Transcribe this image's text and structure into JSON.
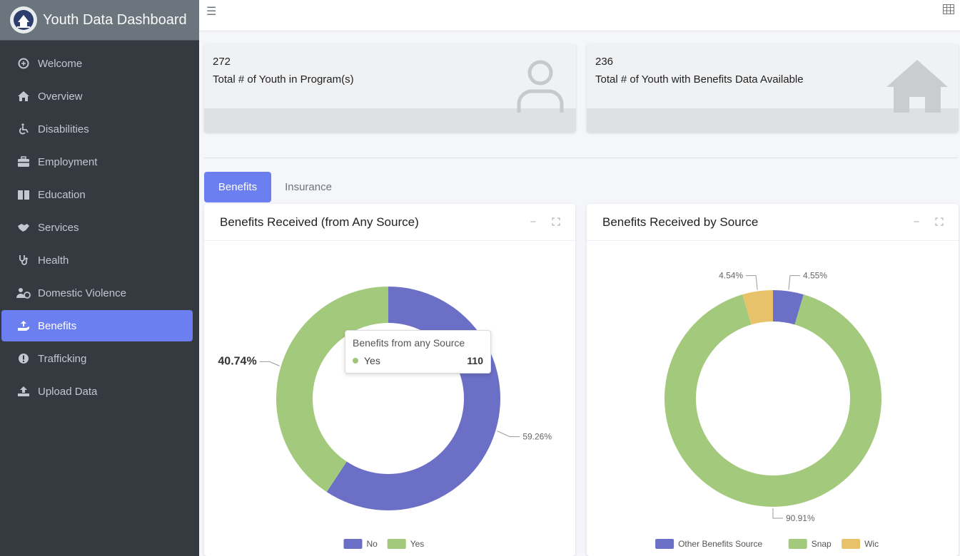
{
  "app": {
    "title": "Youth Data Dashboard"
  },
  "sidebar": {
    "items": [
      {
        "label": "Welcome",
        "icon": "hand-icon"
      },
      {
        "label": "Overview",
        "icon": "home-icon"
      },
      {
        "label": "Disabilities",
        "icon": "wheelchair-icon"
      },
      {
        "label": "Employment",
        "icon": "briefcase-icon"
      },
      {
        "label": "Education",
        "icon": "book-icon"
      },
      {
        "label": "Services",
        "icon": "handshake-icon"
      },
      {
        "label": "Health",
        "icon": "stethoscope-icon"
      },
      {
        "label": "Domestic Violence",
        "icon": "user-shield-icon"
      },
      {
        "label": "Benefits",
        "icon": "hand-holding-icon",
        "active": true
      },
      {
        "label": "Trafficking",
        "icon": "exclamation-circle-icon"
      },
      {
        "label": "Upload Data",
        "icon": "upload-icon"
      }
    ]
  },
  "info_boxes": [
    {
      "value": "272",
      "label": "Total # of Youth in Program(s)",
      "icon": "user-icon"
    },
    {
      "value": "236",
      "label": "Total # of Youth with Benefits Data Available",
      "icon": "house-icon"
    }
  ],
  "tabs": [
    {
      "label": "Benefits",
      "active": true
    },
    {
      "label": "Insurance",
      "active": false
    }
  ],
  "cards": [
    {
      "title": "Benefits Received (from Any Source)"
    },
    {
      "title": "Benefits Received by Source"
    }
  ],
  "tooltip": {
    "title": "Benefits from any Source",
    "series": "Yes",
    "value": "110"
  },
  "colors": {
    "accent": "#6c7ff0",
    "purple": "#6b6fc6",
    "green": "#a3c97d",
    "yellow": "#e8c26a",
    "sidebar": "#343a40"
  },
  "chart_data": [
    {
      "type": "pie",
      "title": "Benefits Received (from Any Source)",
      "categories": [
        "No",
        "Yes"
      ],
      "values": [
        59.26,
        40.74
      ],
      "value_labels": [
        "59.26%",
        "40.74%"
      ],
      "legend": "bottom"
    },
    {
      "type": "pie",
      "title": "Benefits Received by Source",
      "categories": [
        "Other Benefits Source",
        "Snap",
        "Wic"
      ],
      "values": [
        4.55,
        90.91,
        4.54
      ],
      "value_labels": [
        "4.55%",
        "90.91%",
        "4.54%"
      ],
      "legend": "bottom"
    }
  ]
}
